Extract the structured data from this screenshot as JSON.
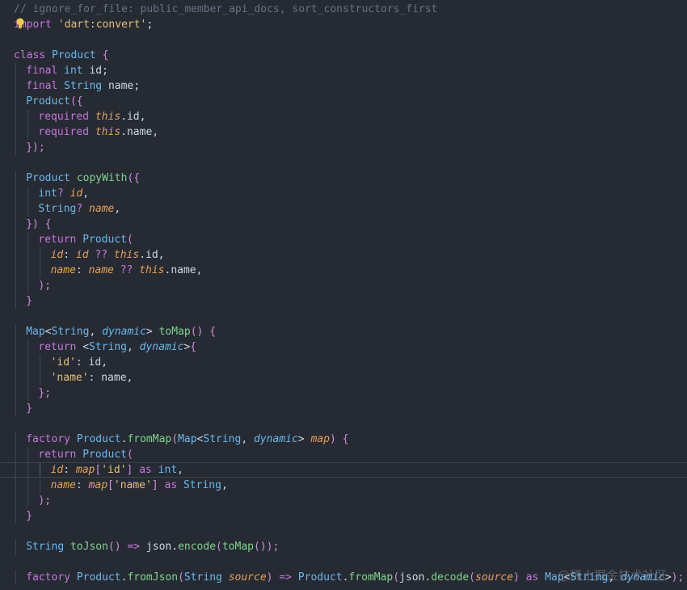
{
  "editor": {
    "lines": [
      {
        "indent": 0,
        "tokens": [
          [
            "// ignore_for_file: public_member_api_docs, sort_constructors_first",
            "comment"
          ]
        ]
      },
      {
        "indent": 0,
        "tokens": [
          [
            "import",
            "keyword"
          ],
          [
            " ",
            "plain"
          ],
          [
            "'dart:convert'",
            "string"
          ],
          [
            ";",
            "punct"
          ]
        ]
      },
      {
        "indent": 0,
        "tokens": []
      },
      {
        "indent": 0,
        "tokens": [
          [
            "class",
            "keyword"
          ],
          [
            " ",
            "plain"
          ],
          [
            "Product",
            "type"
          ],
          [
            " ",
            "plain"
          ],
          [
            "{",
            "paren"
          ]
        ]
      },
      {
        "indent": 1,
        "tokens": [
          [
            "final",
            "keyword"
          ],
          [
            " ",
            "plain"
          ],
          [
            "int",
            "type"
          ],
          [
            " id",
            "plain"
          ],
          [
            ";",
            "punct"
          ]
        ]
      },
      {
        "indent": 1,
        "tokens": [
          [
            "final",
            "keyword"
          ],
          [
            " ",
            "plain"
          ],
          [
            "String",
            "type"
          ],
          [
            " name",
            "plain"
          ],
          [
            ";",
            "punct"
          ]
        ]
      },
      {
        "indent": 1,
        "tokens": [
          [
            "Product",
            "type"
          ],
          [
            "({",
            "paren"
          ]
        ]
      },
      {
        "indent": 2,
        "tokens": [
          [
            "required",
            "keyword"
          ],
          [
            " ",
            "plain"
          ],
          [
            "this",
            "this"
          ],
          [
            ".id",
            "plain"
          ],
          [
            ",",
            "punct"
          ]
        ]
      },
      {
        "indent": 2,
        "tokens": [
          [
            "required",
            "keyword"
          ],
          [
            " ",
            "plain"
          ],
          [
            "this",
            "this"
          ],
          [
            ".name",
            "plain"
          ],
          [
            ",",
            "punct"
          ]
        ]
      },
      {
        "indent": 1,
        "tokens": [
          [
            "});",
            "paren"
          ]
        ]
      },
      {
        "indent": 0,
        "tokens": []
      },
      {
        "indent": 1,
        "tokens": [
          [
            "Product",
            "type"
          ],
          [
            " ",
            "plain"
          ],
          [
            "copyWith",
            "func"
          ],
          [
            "({",
            "paren"
          ]
        ]
      },
      {
        "indent": 2,
        "tokens": [
          [
            "int",
            "type"
          ],
          [
            "?",
            "operator"
          ],
          [
            " ",
            "plain"
          ],
          [
            "id",
            "param"
          ],
          [
            ",",
            "punct"
          ]
        ]
      },
      {
        "indent": 2,
        "tokens": [
          [
            "String",
            "type"
          ],
          [
            "?",
            "operator"
          ],
          [
            " ",
            "plain"
          ],
          [
            "name",
            "param"
          ],
          [
            ",",
            "punct"
          ]
        ]
      },
      {
        "indent": 1,
        "tokens": [
          [
            "})",
            "paren"
          ],
          [
            " ",
            "plain"
          ],
          [
            "{",
            "paren"
          ]
        ]
      },
      {
        "indent": 2,
        "tokens": [
          [
            "return",
            "keyword"
          ],
          [
            " ",
            "plain"
          ],
          [
            "Product",
            "type"
          ],
          [
            "(",
            "paren"
          ]
        ]
      },
      {
        "indent": 3,
        "tokens": [
          [
            "id",
            "param"
          ],
          [
            ":",
            "punct"
          ],
          [
            " ",
            "plain"
          ],
          [
            "id",
            "param"
          ],
          [
            " ",
            "plain"
          ],
          [
            "??",
            "operator"
          ],
          [
            " ",
            "plain"
          ],
          [
            "this",
            "this"
          ],
          [
            ".id",
            "plain"
          ],
          [
            ",",
            "punct"
          ]
        ]
      },
      {
        "indent": 3,
        "tokens": [
          [
            "name",
            "param"
          ],
          [
            ":",
            "punct"
          ],
          [
            " ",
            "plain"
          ],
          [
            "name",
            "param"
          ],
          [
            " ",
            "plain"
          ],
          [
            "??",
            "operator"
          ],
          [
            " ",
            "plain"
          ],
          [
            "this",
            "this"
          ],
          [
            ".name",
            "plain"
          ],
          [
            ",",
            "punct"
          ]
        ]
      },
      {
        "indent": 2,
        "tokens": [
          [
            ");",
            "paren"
          ]
        ]
      },
      {
        "indent": 1,
        "tokens": [
          [
            "}",
            "paren"
          ]
        ]
      },
      {
        "indent": 0,
        "tokens": []
      },
      {
        "indent": 1,
        "tokens": [
          [
            "Map",
            "type"
          ],
          [
            "<",
            "punct"
          ],
          [
            "String",
            "type"
          ],
          [
            ", ",
            "punct"
          ],
          [
            "dynamic",
            "dyn"
          ],
          [
            ">",
            "punct"
          ],
          [
            " ",
            "plain"
          ],
          [
            "toMap",
            "func"
          ],
          [
            "()",
            "paren"
          ],
          [
            " ",
            "plain"
          ],
          [
            "{",
            "paren"
          ]
        ]
      },
      {
        "indent": 2,
        "tokens": [
          [
            "return",
            "keyword"
          ],
          [
            " ",
            "plain"
          ],
          [
            "<",
            "punct"
          ],
          [
            "String",
            "type"
          ],
          [
            ", ",
            "punct"
          ],
          [
            "dynamic",
            "dyn"
          ],
          [
            ">",
            "punct"
          ],
          [
            "{",
            "paren"
          ]
        ]
      },
      {
        "indent": 3,
        "tokens": [
          [
            "'id'",
            "string"
          ],
          [
            ": id",
            "plain"
          ],
          [
            ",",
            "punct"
          ]
        ]
      },
      {
        "indent": 3,
        "tokens": [
          [
            "'name'",
            "string"
          ],
          [
            ": name",
            "plain"
          ],
          [
            ",",
            "punct"
          ]
        ]
      },
      {
        "indent": 2,
        "tokens": [
          [
            "};",
            "paren"
          ]
        ]
      },
      {
        "indent": 1,
        "tokens": [
          [
            "}",
            "paren"
          ]
        ]
      },
      {
        "indent": 0,
        "tokens": []
      },
      {
        "indent": 1,
        "tokens": [
          [
            "factory",
            "keyword"
          ],
          [
            " ",
            "plain"
          ],
          [
            "Product",
            "type"
          ],
          [
            ".",
            "punct"
          ],
          [
            "fromMap",
            "func"
          ],
          [
            "(",
            "paren"
          ],
          [
            "Map",
            "type"
          ],
          [
            "<",
            "punct"
          ],
          [
            "String",
            "type"
          ],
          [
            ", ",
            "punct"
          ],
          [
            "dynamic",
            "dyn"
          ],
          [
            "> ",
            "punct"
          ],
          [
            "map",
            "param"
          ],
          [
            ")",
            "paren"
          ],
          [
            " ",
            "plain"
          ],
          [
            "{",
            "paren"
          ]
        ]
      },
      {
        "indent": 2,
        "tokens": [
          [
            "return",
            "keyword"
          ],
          [
            " ",
            "plain"
          ],
          [
            "Product",
            "type"
          ],
          [
            "(",
            "paren"
          ]
        ]
      },
      {
        "indent": 3,
        "current": true,
        "tokens": [
          [
            "id",
            "param"
          ],
          [
            ":",
            "punct"
          ],
          [
            " ",
            "plain"
          ],
          [
            "map",
            "param"
          ],
          [
            "[",
            "paren"
          ],
          [
            "'id'",
            "string"
          ],
          [
            "]",
            "paren"
          ],
          [
            " ",
            "plain"
          ],
          [
            "as",
            "keyword"
          ],
          [
            " ",
            "plain"
          ],
          [
            "int",
            "type"
          ],
          [
            ",",
            "punct"
          ]
        ]
      },
      {
        "indent": 3,
        "tokens": [
          [
            "name",
            "param"
          ],
          [
            ":",
            "punct"
          ],
          [
            " ",
            "plain"
          ],
          [
            "map",
            "param"
          ],
          [
            "[",
            "paren"
          ],
          [
            "'name'",
            "string"
          ],
          [
            "]",
            "paren"
          ],
          [
            " ",
            "plain"
          ],
          [
            "as",
            "keyword"
          ],
          [
            " ",
            "plain"
          ],
          [
            "String",
            "type"
          ],
          [
            ",",
            "punct"
          ]
        ]
      },
      {
        "indent": 2,
        "tokens": [
          [
            ");",
            "paren"
          ]
        ]
      },
      {
        "indent": 1,
        "tokens": [
          [
            "}",
            "paren"
          ]
        ]
      },
      {
        "indent": 0,
        "tokens": []
      },
      {
        "indent": 1,
        "tokens": [
          [
            "String",
            "type"
          ],
          [
            " ",
            "plain"
          ],
          [
            "toJson",
            "func"
          ],
          [
            "()",
            "paren"
          ],
          [
            " ",
            "plain"
          ],
          [
            "=>",
            "operator"
          ],
          [
            " json.",
            "plain"
          ],
          [
            "encode",
            "func"
          ],
          [
            "(",
            "paren"
          ],
          [
            "toMap",
            "func"
          ],
          [
            "()",
            "paren"
          ],
          [
            ");",
            "paren"
          ]
        ]
      },
      {
        "indent": 0,
        "tokens": []
      },
      {
        "indent": 1,
        "tokens": [
          [
            "factory",
            "keyword"
          ],
          [
            " ",
            "plain"
          ],
          [
            "Product",
            "type"
          ],
          [
            ".",
            "punct"
          ],
          [
            "fromJson",
            "func"
          ],
          [
            "(",
            "paren"
          ],
          [
            "String",
            "type"
          ],
          [
            " ",
            "plain"
          ],
          [
            "source",
            "param"
          ],
          [
            ")",
            "paren"
          ],
          [
            " ",
            "plain"
          ],
          [
            "=>",
            "operator"
          ],
          [
            " ",
            "plain"
          ],
          [
            "Product",
            "type"
          ],
          [
            ".",
            "punct"
          ],
          [
            "fromMap",
            "func"
          ],
          [
            "(",
            "paren"
          ],
          [
            "json.",
            "plain"
          ],
          [
            "decode",
            "func"
          ],
          [
            "(",
            "paren"
          ],
          [
            "source",
            "param"
          ],
          [
            ")",
            "paren"
          ],
          [
            " ",
            "plain"
          ],
          [
            "as",
            "keyword"
          ],
          [
            " ",
            "plain"
          ],
          [
            "Map",
            "type"
          ],
          [
            "<",
            "punct"
          ],
          [
            "String",
            "type"
          ],
          [
            ", ",
            "punct"
          ],
          [
            "dynamic",
            "dyn"
          ],
          [
            ">",
            "punct"
          ],
          [
            ");",
            "paren"
          ]
        ]
      }
    ]
  },
  "watermark": "@稀土掘金技术社区",
  "colors": {
    "background": "#262a33",
    "comment": "#687183",
    "keyword": "#c678dd",
    "type": "#6bb8ec",
    "string": "#e3c177",
    "function": "#7fd58c",
    "parameter": "#e7a15a"
  },
  "icons": {
    "lightbulb": "lightbulb-icon"
  }
}
